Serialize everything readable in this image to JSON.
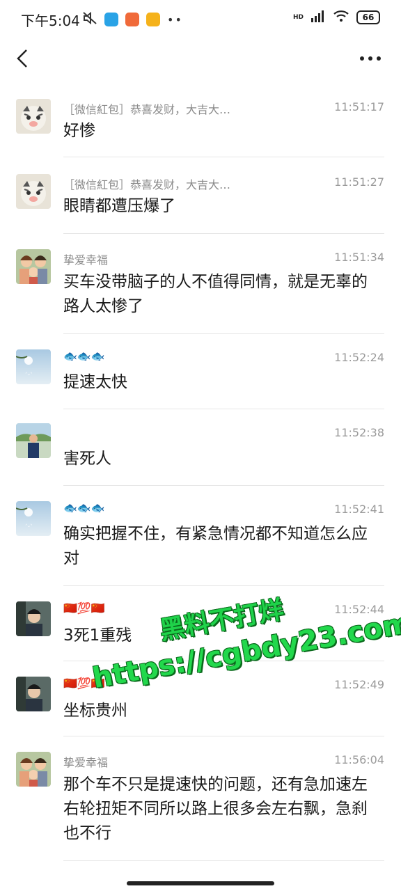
{
  "status": {
    "time": "下午5:04",
    "battery": "66",
    "network": "HD"
  },
  "nav": {
    "back_icon": "chevron-left-icon",
    "more_icon": "more-icon"
  },
  "comments": [
    {
      "avatar": "tiger",
      "name": "［微信紅包］恭喜发财，大吉大…",
      "time": "11:51:17",
      "text": "好惨"
    },
    {
      "avatar": "tiger",
      "name": "［微信紅包］恭喜发财，大吉大…",
      "time": "11:51:27",
      "text": "眼睛都遭压爆了"
    },
    {
      "avatar": "family",
      "name": "挚爱幸福",
      "time": "11:51:34",
      "text": "买车没带脑子的人不值得同情，就是无辜的路人太惨了"
    },
    {
      "avatar": "sky",
      "name": "🐟🐟🐟",
      "time": "11:52:24",
      "text": "提速太快"
    },
    {
      "avatar": "person",
      "name": "",
      "time": "11:52:38",
      "text": "害死人"
    },
    {
      "avatar": "sky",
      "name": "🐟🐟🐟",
      "time": "11:52:41",
      "text": "确实把握不住，有紧急情况都不知道怎么应对"
    },
    {
      "avatar": "man",
      "name": "🇨🇳💯🇨🇳",
      "time": "11:52:44",
      "text": "3死1重残"
    },
    {
      "avatar": "man",
      "name": "🇨🇳💯🇨🇳",
      "time": "11:52:49",
      "text": "坐标贵州"
    },
    {
      "avatar": "family",
      "name": "挚爱幸福",
      "time": "11:56:04",
      "text": "那个车不只是提速快的问题，还有急加速左右轮扭矩不同所以路上很多会左右飘，急刹也不行"
    }
  ],
  "watermark": {
    "line1": "黑料不打烊",
    "line2": "https://cgbdy23.com"
  }
}
